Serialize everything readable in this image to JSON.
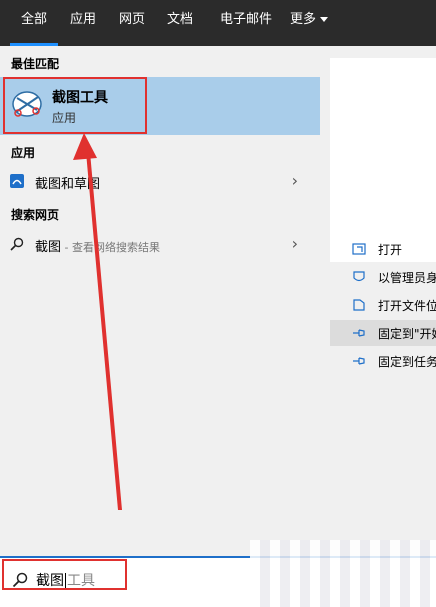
{
  "tabs": [
    {
      "label": "全部",
      "active": true
    },
    {
      "label": "应用"
    },
    {
      "label": "网页"
    },
    {
      "label": "文档"
    },
    {
      "label": "电子邮件"
    },
    {
      "label": "更多"
    }
  ],
  "best_match": {
    "section_label": "最佳匹配",
    "title": "截图工具",
    "subtitle": "应用",
    "icon": "scissors-icon"
  },
  "apps": {
    "section_label": "应用",
    "items": [
      {
        "label": "截图和草图",
        "icon": "snip-sketch-icon"
      }
    ]
  },
  "web": {
    "section_label": "搜索网页",
    "items": [
      {
        "query": "截图",
        "hint": " - 查看网络搜索结果",
        "icon": "search-icon"
      }
    ]
  },
  "actions": [
    {
      "label": "打开",
      "icon": "open-icon"
    },
    {
      "label": "以管理员身",
      "icon": "shield-icon"
    },
    {
      "label": "打开文件位",
      "icon": "folder-icon"
    },
    {
      "label": "固定到\"开始",
      "icon": "pin-icon",
      "highlighted": true
    },
    {
      "label": "固定到任务",
      "icon": "pin-icon"
    }
  ],
  "search": {
    "typed": "截图",
    "ghost": "工具"
  },
  "colors": {
    "accent": "#1e90ff",
    "selection": "#a9cdea",
    "annotation": "#e0312f",
    "tabbar": "#2b2b2b"
  }
}
